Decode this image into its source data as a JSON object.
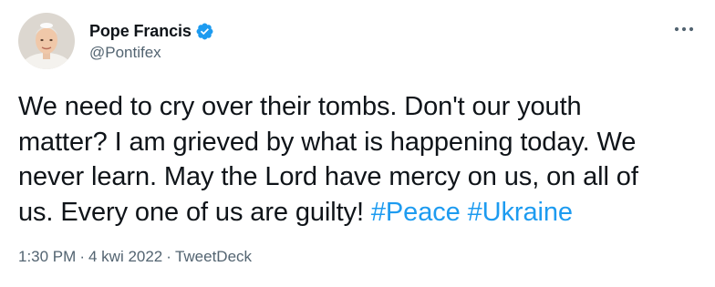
{
  "author": {
    "display_name": "Pope Francis",
    "handle": "@Pontifex",
    "verified": true,
    "avatar": "profile-photo"
  },
  "icons": {
    "verified": "verified-badge-icon",
    "more": "more-horizontal-icon"
  },
  "colors": {
    "text": "#0f1419",
    "secondary": "#536471",
    "link": "#1d9bf0",
    "verified": "#1d9bf0"
  },
  "tweet": {
    "text_line_1": "We need to cry over their tombs. Don't our youth",
    "text_line_2": "matter? I am grieved by what is happening today. We",
    "text_line_3": "never learn. May the Lord have mercy on us, on all of",
    "text_line_4": "us. Every one of us are guilty!",
    "hashtag_1": "#Peace",
    "hashtag_2": "#Ukraine"
  },
  "meta": {
    "time": "1:30 PM",
    "separator": "·",
    "date": "4 kwi 2022",
    "source": "TweetDeck"
  }
}
